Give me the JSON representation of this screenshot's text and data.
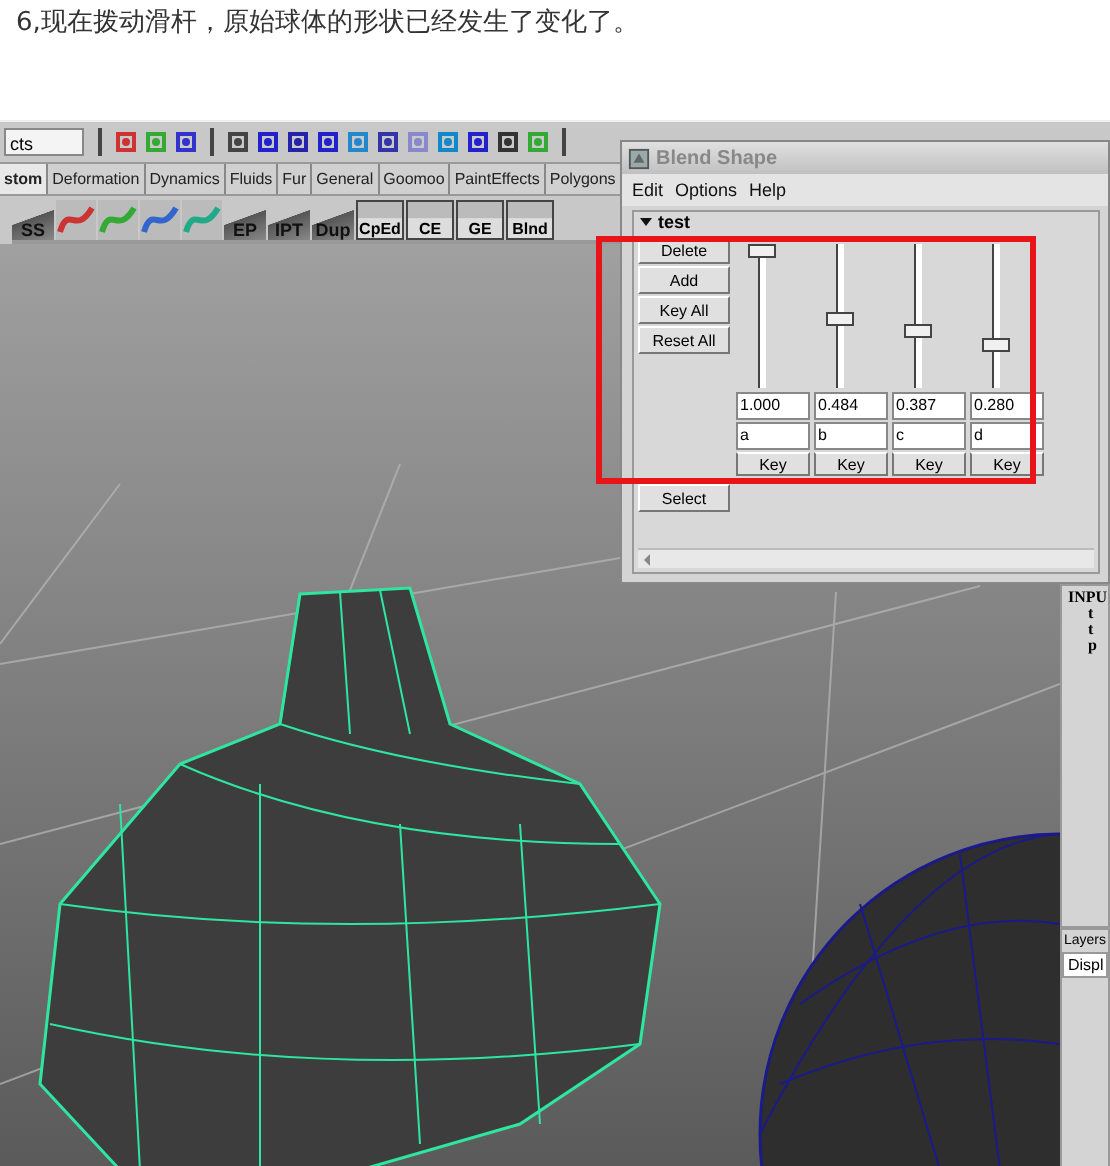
{
  "caption": "6,现在拨动滑杆，原始球体的形状已经发生了变化了。",
  "toolbar": {
    "field_value": "cts"
  },
  "shelf_tabs": [
    {
      "label": "stom",
      "selected": true
    },
    {
      "label": "Deformation",
      "selected": false
    },
    {
      "label": "Dynamics",
      "selected": false
    },
    {
      "label": "Fluids",
      "selected": false
    },
    {
      "label": "Fur",
      "selected": false
    },
    {
      "label": "General",
      "selected": false
    },
    {
      "label": "Goomoo",
      "selected": false
    },
    {
      "label": "PaintEffects",
      "selected": false
    },
    {
      "label": "Polygons",
      "selected": false
    }
  ],
  "shelf_items": [
    {
      "kind": "labeled",
      "label": "SS"
    },
    {
      "kind": "icon"
    },
    {
      "kind": "icon"
    },
    {
      "kind": "icon"
    },
    {
      "kind": "icon"
    },
    {
      "kind": "labeled",
      "label": "EP"
    },
    {
      "kind": "labeled",
      "label": "IPT"
    },
    {
      "kind": "labeled",
      "label": "Dup"
    },
    {
      "kind": "blank",
      "label": "CpEd"
    },
    {
      "kind": "blank",
      "label": "CE"
    },
    {
      "kind": "blank",
      "label": "GE"
    },
    {
      "kind": "blank",
      "label": "Blnd"
    }
  ],
  "blend_window": {
    "title": "Blend Shape",
    "menu": [
      "Edit",
      "Options",
      "Help"
    ],
    "section": {
      "name": "test",
      "expanded": true
    },
    "buttons": [
      "Delete",
      "Add",
      "Key All",
      "Reset All"
    ],
    "targets": [
      {
        "level": 1.0,
        "value": "1.000",
        "name": "a",
        "key": "Key"
      },
      {
        "level": 0.484,
        "value": "0.484",
        "name": "b",
        "key": "Key"
      },
      {
        "level": 0.387,
        "value": "0.387",
        "name": "c",
        "key": "Key"
      },
      {
        "level": 0.28,
        "value": "0.280",
        "name": "d",
        "key": "Key"
      }
    ],
    "select_button": "Select"
  },
  "channel_box": {
    "lines": [
      "INPU",
      "t",
      "t",
      "p"
    ]
  },
  "layers": {
    "title": "Layers",
    "tab": "Displ"
  }
}
